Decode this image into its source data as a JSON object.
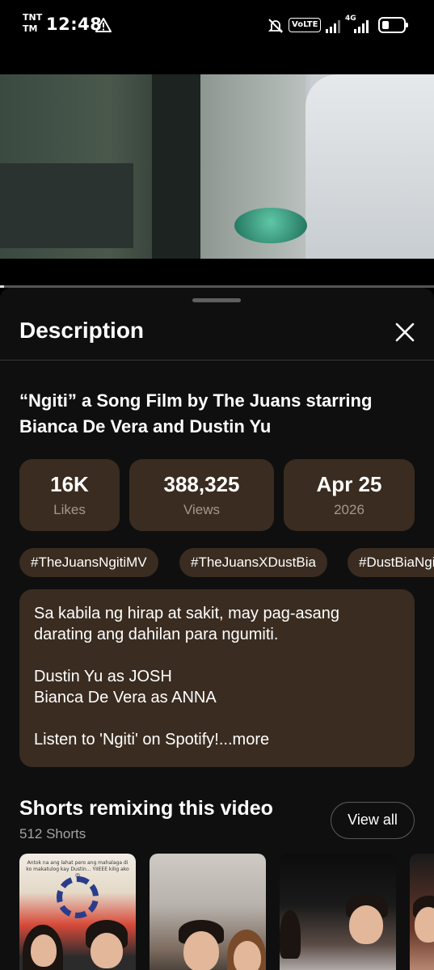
{
  "status_bar": {
    "carrier_line1": "TNT",
    "carrier_line2": "TM",
    "time": "12:48",
    "volte": "VoLTE",
    "network": "4G",
    "icons": [
      "warning-icon",
      "mute-icon",
      "signal-icon",
      "battery-icon"
    ]
  },
  "video": {
    "progress_fraction": 0.01
  },
  "sheet": {
    "title": "Description",
    "video_title": "“Ngiti” a Song Film by The Juans starring Bianca De Vera and Dustin Yu",
    "stats": [
      {
        "value": "16K",
        "label": "Likes"
      },
      {
        "value": "388,325",
        "label": "Views"
      },
      {
        "value": "Apr 25",
        "label": "2026"
      }
    ],
    "hashtags": [
      "#TheJuansNgitiMV",
      "#TheJuansXDustBia",
      "#DustBiaNgiti"
    ],
    "description": {
      "line1": "Sa kabila ng hirap at sakit, may pag-asang",
      "line2": "darating ang dahilan para ngumiti.",
      "line3": "Dustin Yu as JOSH",
      "line4": "Bianca De Vera as ANNA",
      "line5": "Listen to 'Ngiti' on Spotify!",
      "more": "...more"
    },
    "shorts": {
      "title": "Shorts remixing this video",
      "count": "512 Shorts",
      "view_all": "View all",
      "first_caption": "Antok na ang lahat pero ang mahalaga di ko makatulog kay Dustin... YIIEEE kilig ako 😍"
    }
  },
  "colors": {
    "background": "#0f0f0f",
    "card": "#3a2c20",
    "muted_text": "#a3988e"
  }
}
